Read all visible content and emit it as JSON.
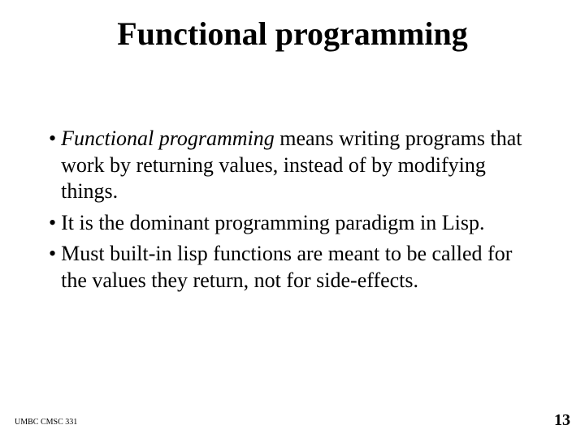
{
  "title": "Functional programming",
  "bullets": [
    {
      "emphasis": "Functional programming",
      "rest": "  means writing programs that work by returning values, instead of by modifying things."
    },
    {
      "emphasis": "",
      "rest": "It is the dominant programming paradigm in Lisp."
    },
    {
      "emphasis": "",
      "rest": "Must built-in lisp functions are meant to be called for the values they return, not for side-effects."
    }
  ],
  "footer_left": "UMBC CMSC 331",
  "footer_right": "13"
}
